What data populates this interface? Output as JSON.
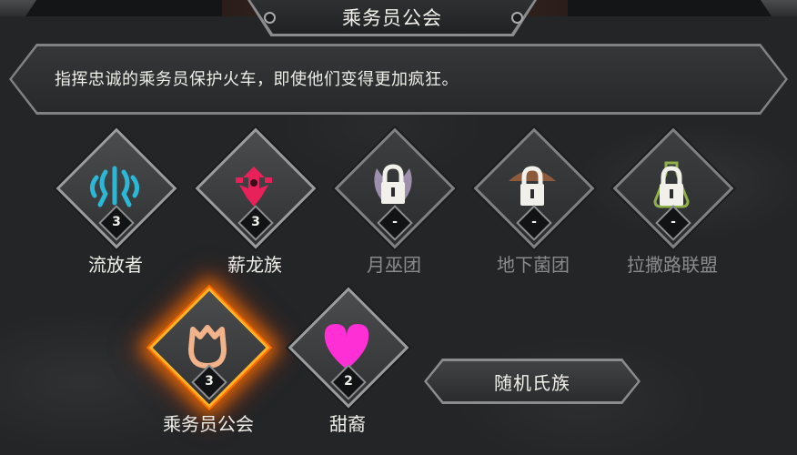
{
  "title": "乘务员公会",
  "description": "指挥忠诚的乘务员保护火车，即使他们变得更加疯狂。",
  "clans": [
    {
      "name": "流放者",
      "level": "3",
      "locked": false,
      "icon": "exiles-sigil-icon",
      "color": "#2bb7d6"
    },
    {
      "name": "薪龙族",
      "level": "3",
      "locked": false,
      "icon": "dragon-clan-sigil-icon",
      "color": "#e8215a"
    },
    {
      "name": "月巫团",
      "level": "-",
      "locked": true,
      "icon": "lock-icon",
      "color": "#b9a7c9"
    },
    {
      "name": "地下菌团",
      "level": "-",
      "locked": true,
      "icon": "lock-icon",
      "color": "#8e5a3c"
    },
    {
      "name": "拉撒路联盟",
      "level": "-",
      "locked": true,
      "icon": "lock-icon",
      "color": "#8fb04a"
    },
    {
      "name": "乘务员公会",
      "level": "3",
      "locked": false,
      "selected": true,
      "icon": "tulip-sigil-icon",
      "color": "#f2b28a"
    },
    {
      "name": "甜裔",
      "level": "2",
      "locked": false,
      "icon": "heart-sigil-icon",
      "color": "#ff2fd6"
    }
  ],
  "random_button": "随机氏族",
  "colors": {
    "accent_glow": "#ff8a00",
    "frame": "#8a8c8e"
  }
}
